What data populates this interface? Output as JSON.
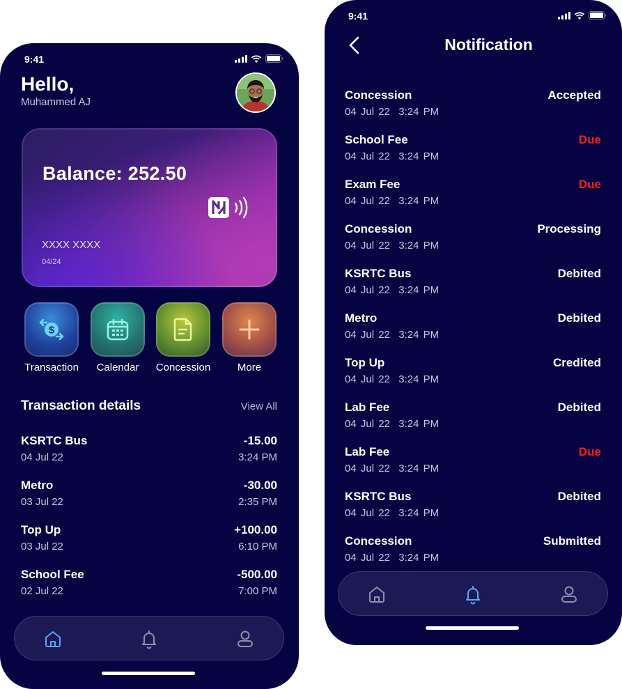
{
  "colors": {
    "background": "#060343",
    "due": "#ff1c1c",
    "accent_blue": "#5aa7f5",
    "muted_icon": "#8f8eae"
  },
  "home": {
    "status_time": "9:41",
    "greeting": "Hello,",
    "user_name": "Muhammed AJ",
    "card": {
      "balance": "Balance: 252.50",
      "number": "XXXX XXXX",
      "expiry": "04/24"
    },
    "actions": [
      {
        "label": "Transaction",
        "icon": "dollar-exchange-icon"
      },
      {
        "label": "Calendar",
        "icon": "calendar-icon"
      },
      {
        "label": "Concession",
        "icon": "document-icon"
      },
      {
        "label": "More",
        "icon": "plus-icon"
      }
    ],
    "section_title": "Transaction details",
    "view_all": "View All",
    "transactions": [
      {
        "name": "KSRTC Bus",
        "date": "04 Jul 22",
        "amount": "-15.00",
        "time": "3:24 PM"
      },
      {
        "name": "Metro",
        "date": "03 Jul 22",
        "amount": "-30.00",
        "time": "2:35 PM"
      },
      {
        "name": "Top Up",
        "date": "03 Jul 22",
        "amount": "+100.00",
        "time": "6:10 PM"
      },
      {
        "name": "School Fee",
        "date": "02 Jul 22",
        "amount": "-500.00",
        "time": "7:00 PM"
      }
    ],
    "nav": [
      {
        "icon": "home-icon",
        "active": true
      },
      {
        "icon": "bell-icon",
        "active": false
      },
      {
        "icon": "user-icon",
        "active": false
      }
    ]
  },
  "notifications": {
    "status_time": "9:41",
    "title": "Notification",
    "items": [
      {
        "name": "Concession",
        "date": "04 Jul 22  3:24 PM",
        "status": "Accepted",
        "due": false
      },
      {
        "name": "School Fee",
        "date": "04 Jul 22  3:24 PM",
        "status": "Due",
        "due": true
      },
      {
        "name": "Exam Fee",
        "date": "04 Jul 22  3:24 PM",
        "status": "Due",
        "due": true
      },
      {
        "name": "Concession",
        "date": "04 Jul 22  3:24 PM",
        "status": "Processing",
        "due": false
      },
      {
        "name": "KSRTC Bus",
        "date": "04 Jul 22  3:24 PM",
        "status": "Debited",
        "due": false
      },
      {
        "name": "Metro",
        "date": "04 Jul 22  3:24 PM",
        "status": "Debited",
        "due": false
      },
      {
        "name": "Top Up",
        "date": "04 Jul 22  3:24 PM",
        "status": "Credited",
        "due": false
      },
      {
        "name": "Lab Fee",
        "date": "04 Jul 22  3:24 PM",
        "status": "Debited",
        "due": false
      },
      {
        "name": "Lab Fee",
        "date": "04 Jul 22  3:24 PM",
        "status": "Due",
        "due": true
      },
      {
        "name": "KSRTC Bus",
        "date": "04 Jul 22  3:24 PM",
        "status": "Debited",
        "due": false
      },
      {
        "name": "Concession",
        "date": "04 Jul 22  3:24 PM",
        "status": "Submitted",
        "due": false
      }
    ],
    "nav": [
      {
        "icon": "home-icon",
        "active": false
      },
      {
        "icon": "bell-icon",
        "active": true
      },
      {
        "icon": "user-icon",
        "active": false
      }
    ]
  }
}
